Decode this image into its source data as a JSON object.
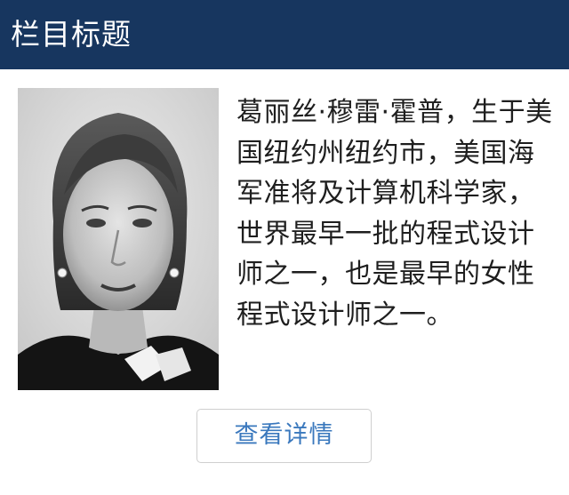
{
  "header": {
    "title": "栏目标题",
    "background_color": "#17365f"
  },
  "article": {
    "portrait_description": "black-and-white portrait photo of a woman",
    "description": "葛丽丝·穆雷·霍普，生于美国纽约州纽约市，美国海军准将及计算机科学家，世界最早一批的程式设计师之一，也是最早的女性程式设计师之一。"
  },
  "actions": {
    "details_label": "查看详情",
    "accent_color": "#3a78bd"
  }
}
